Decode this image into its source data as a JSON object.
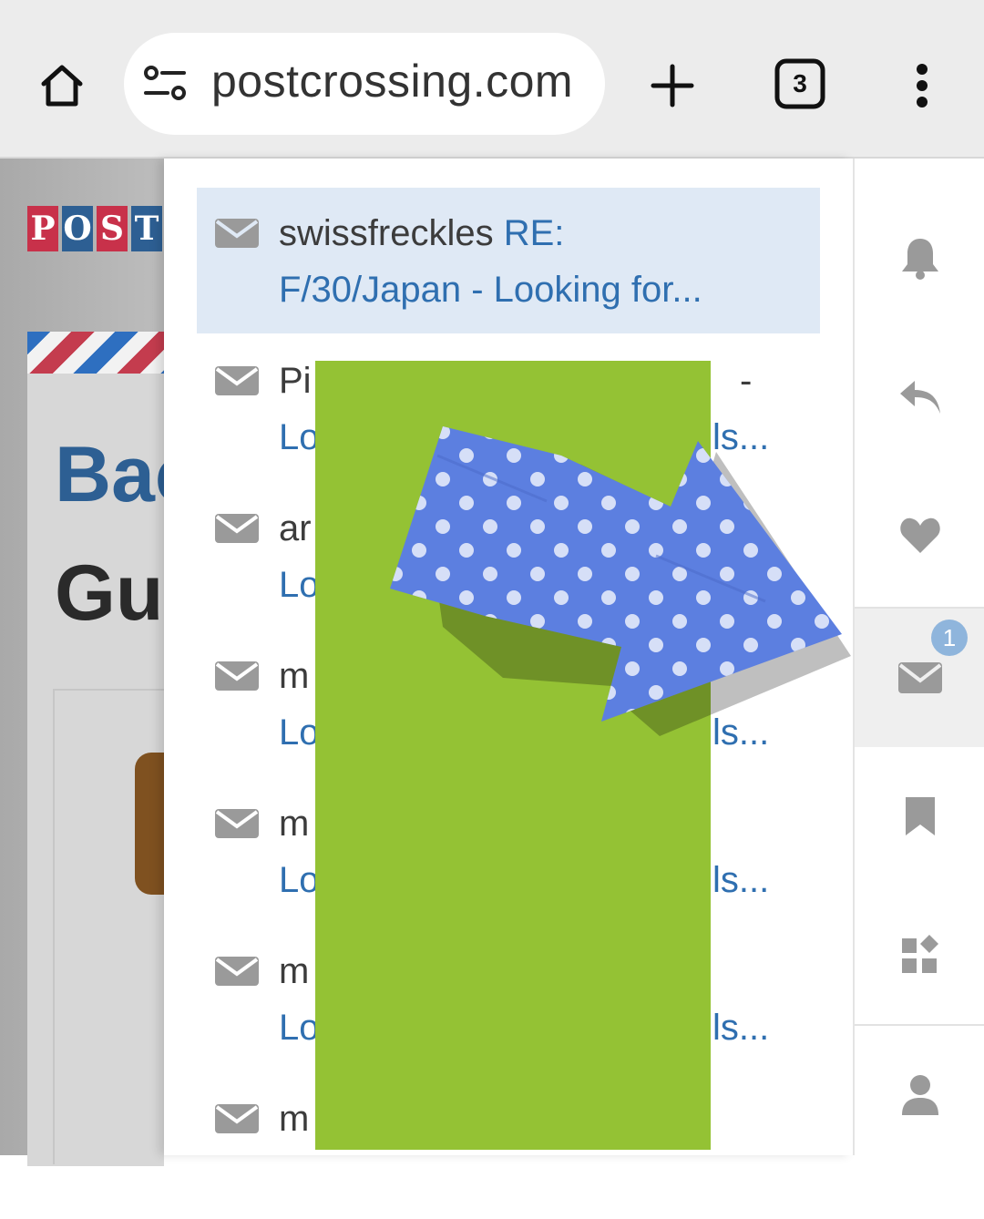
{
  "browser": {
    "url": "postcrossing.com",
    "tab_count": "3"
  },
  "background_page": {
    "logo_letters": [
      "P",
      "O",
      "S",
      "T"
    ],
    "logo_colors": [
      "#c8314a",
      "#2d5f93",
      "#c8314a",
      "#2d5f93"
    ],
    "title_fragment_1": "Bac",
    "title_fragment_2": "Gui"
  },
  "messages": [
    {
      "sender": "swissfreckles",
      "subject_start": "RE:",
      "subject_line2": "F/30/Japan - Looking for...",
      "selected": true
    },
    {
      "sender_fragment": "Pi",
      "right_fragment_1": "-",
      "left_fragment_2": "Lo",
      "right_fragment_2": "ls..."
    },
    {
      "sender_fragment": "ar",
      "left_fragment_2": "Lo"
    },
    {
      "sender_fragment": "m",
      "left_fragment_2": "Lo",
      "right_fragment_2": "ls..."
    },
    {
      "sender_fragment": "m",
      "left_fragment_2": "Lo",
      "right_fragment_2": "ls..."
    },
    {
      "sender_fragment": "m",
      "left_fragment_2": "Lo",
      "right_fragment_2": "ls..."
    },
    {
      "sender_fragment": "m"
    }
  ],
  "rail": {
    "items": [
      "bell-icon",
      "reply-icon",
      "heart-icon",
      "mail-icon",
      "bookmark-icon",
      "widgets-icon",
      "user-icon"
    ],
    "mail_badge": "1",
    "active": "mail-icon"
  },
  "colors": {
    "link": "#2f6fb0",
    "selected_row": "#dfe9f5",
    "redaction": "#94c234",
    "badge": "#8fb5dc"
  }
}
